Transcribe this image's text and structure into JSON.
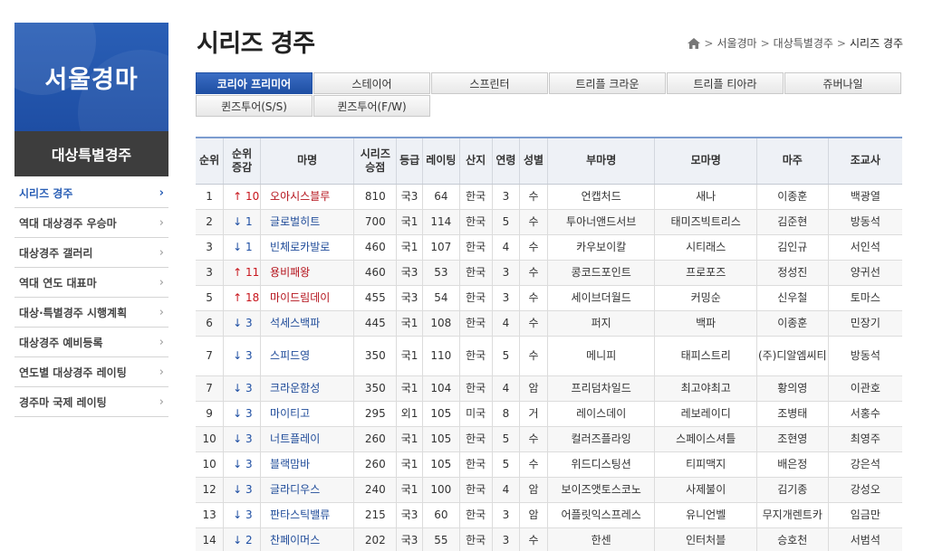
{
  "sidebar": {
    "logo_text": "서울경마",
    "subtitle": "대상특별경주",
    "items": [
      {
        "label": "시리즈 경주",
        "active": true
      },
      {
        "label": "역대 대상경주 우승마",
        "active": false
      },
      {
        "label": "대상경주 갤러리",
        "active": false
      },
      {
        "label": "역대 연도 대표마",
        "active": false
      },
      {
        "label": "대상·특별경주 시행계획",
        "active": false
      },
      {
        "label": "대상경주 예비등록",
        "active": false
      },
      {
        "label": "연도별 대상경주 레이팅",
        "active": false
      },
      {
        "label": "경주마 국제 레이팅",
        "active": false
      }
    ],
    "chevron": "›"
  },
  "header": {
    "title": "시리즈 경주",
    "breadcrumb": [
      "서울경마",
      "대상특별경주",
      "시리즈 경주"
    ],
    "breadcrumb_sep": ">"
  },
  "tabs": {
    "row1": [
      "코리아 프리미어",
      "스테이어",
      "스프린터",
      "트리플 크라운",
      "트리플 티아라",
      "쥬버나일"
    ],
    "row2": [
      "퀸즈투어(S/S)",
      "퀸즈투어(F/W)"
    ],
    "active_index": 0
  },
  "table": {
    "headers": [
      "순위",
      "순위\n증감",
      "마명",
      "시리즈\n승점",
      "등급",
      "레이팅",
      "산지",
      "연령",
      "성별",
      "부마명",
      "모마명",
      "마주",
      "조교사"
    ],
    "rows": [
      {
        "rank": "1",
        "change": "↑ 10",
        "dir": "up",
        "horse": "오아시스블루",
        "points": "810",
        "grade": "국3",
        "rating": "64",
        "origin": "한국",
        "age": "3",
        "sex": "수",
        "sire": "언캡처드",
        "dam": "새나",
        "owner": "이종훈",
        "trainer": "백광열"
      },
      {
        "rank": "2",
        "change": "↓ 1",
        "dir": "down",
        "horse": "글로벌히트",
        "points": "700",
        "grade": "국1",
        "rating": "114",
        "origin": "한국",
        "age": "5",
        "sex": "수",
        "sire": "투아너앤드서브",
        "dam": "태미즈빅트리스",
        "owner": "김준현",
        "trainer": "방동석"
      },
      {
        "rank": "3",
        "change": "↓ 1",
        "dir": "down",
        "horse": "빈체로카발로",
        "points": "460",
        "grade": "국1",
        "rating": "107",
        "origin": "한국",
        "age": "4",
        "sex": "수",
        "sire": "카우보이칼",
        "dam": "시티래스",
        "owner": "김인규",
        "trainer": "서인석"
      },
      {
        "rank": "3",
        "change": "↑ 11",
        "dir": "up",
        "horse": "용비패왕",
        "points": "460",
        "grade": "국3",
        "rating": "53",
        "origin": "한국",
        "age": "3",
        "sex": "수",
        "sire": "콩코드포인트",
        "dam": "프로포즈",
        "owner": "정성진",
        "trainer": "양귀선"
      },
      {
        "rank": "5",
        "change": "↑ 18",
        "dir": "up",
        "horse": "마이드림데이",
        "points": "455",
        "grade": "국3",
        "rating": "54",
        "origin": "한국",
        "age": "3",
        "sex": "수",
        "sire": "세이브더월드",
        "dam": "커밍순",
        "owner": "신우철",
        "trainer": "토마스"
      },
      {
        "rank": "6",
        "change": "↓ 3",
        "dir": "down",
        "horse": "석세스백파",
        "points": "445",
        "grade": "국1",
        "rating": "108",
        "origin": "한국",
        "age": "4",
        "sex": "수",
        "sire": "퍼지",
        "dam": "백파",
        "owner": "이종훈",
        "trainer": "민장기"
      },
      {
        "rank": "7",
        "change": "↓ 3",
        "dir": "down",
        "horse": "스피드영",
        "points": "350",
        "grade": "국1",
        "rating": "110",
        "origin": "한국",
        "age": "5",
        "sex": "수",
        "sire": "메니피",
        "dam": "태피스트리",
        "owner": "(주)디알엠씨티",
        "trainer": "방동석",
        "tall": true
      },
      {
        "rank": "7",
        "change": "↓ 3",
        "dir": "down",
        "horse": "크라운함성",
        "points": "350",
        "grade": "국1",
        "rating": "104",
        "origin": "한국",
        "age": "4",
        "sex": "암",
        "sire": "프리덤차일드",
        "dam": "최고야최고",
        "owner": "황의영",
        "trainer": "이관호"
      },
      {
        "rank": "9",
        "change": "↓ 3",
        "dir": "down",
        "horse": "마이티고",
        "points": "295",
        "grade": "외1",
        "rating": "105",
        "origin": "미국",
        "age": "8",
        "sex": "거",
        "sire": "레이스데이",
        "dam": "레보레이디",
        "owner": "조병태",
        "trainer": "서홍수"
      },
      {
        "rank": "10",
        "change": "↓ 3",
        "dir": "down",
        "horse": "너트플레이",
        "points": "260",
        "grade": "국1",
        "rating": "105",
        "origin": "한국",
        "age": "5",
        "sex": "수",
        "sire": "컬러즈플라잉",
        "dam": "스페이스셔틀",
        "owner": "조현영",
        "trainer": "최영주"
      },
      {
        "rank": "10",
        "change": "↓ 3",
        "dir": "down",
        "horse": "블랙맘바",
        "points": "260",
        "grade": "국1",
        "rating": "105",
        "origin": "한국",
        "age": "5",
        "sex": "수",
        "sire": "위드디스팅션",
        "dam": "티피맥지",
        "owner": "배은정",
        "trainer": "강은석"
      },
      {
        "rank": "12",
        "change": "↓ 3",
        "dir": "down",
        "horse": "글라디우스",
        "points": "240",
        "grade": "국1",
        "rating": "100",
        "origin": "한국",
        "age": "4",
        "sex": "암",
        "sire": "보이즈앳토스코노",
        "dam": "사제불이",
        "owner": "김기종",
        "trainer": "강성오"
      },
      {
        "rank": "13",
        "change": "↓ 3",
        "dir": "down",
        "horse": "판타스틱밸류",
        "points": "215",
        "grade": "국3",
        "rating": "60",
        "origin": "한국",
        "age": "3",
        "sex": "암",
        "sire": "어플릿익스프레스",
        "dam": "유니언벨",
        "owner": "무지개렌트카",
        "trainer": "임금만"
      },
      {
        "rank": "14",
        "change": "↓ 2",
        "dir": "down",
        "horse": "찬페이머스",
        "points": "202",
        "grade": "국3",
        "rating": "55",
        "origin": "한국",
        "age": "3",
        "sex": "수",
        "sire": "한센",
        "dam": "인터처블",
        "owner": "승호천",
        "trainer": "서범석"
      }
    ]
  },
  "colors": {
    "brand_blue": "#2a5fb6",
    "up_red": "#c8161d",
    "down_blue": "#1f4fa3",
    "horse_link": "#1f4b99"
  }
}
